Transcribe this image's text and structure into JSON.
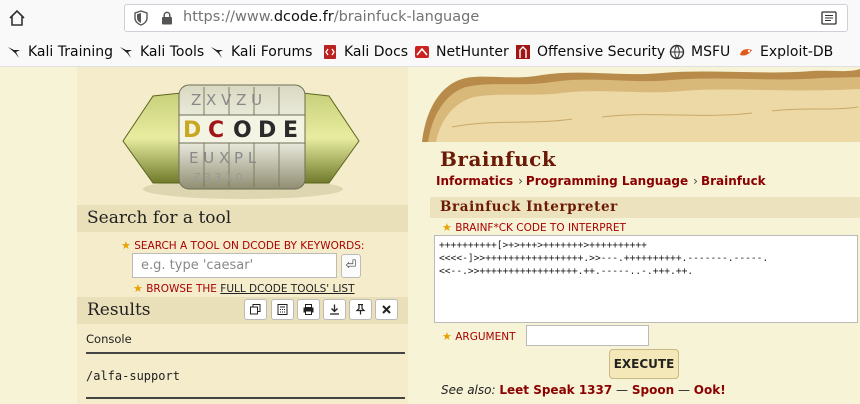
{
  "browser": {
    "url_prefix": "https://www.",
    "url_host": "dcode.fr",
    "url_path": "/brainfuck-language"
  },
  "bookmarks": [
    {
      "label": "Kali Training",
      "icon": "kali-dragon-icon"
    },
    {
      "label": "Kali Tools",
      "icon": "kali-dragon-icon"
    },
    {
      "label": "Kali Forums",
      "icon": "kali-dragon-icon"
    },
    {
      "label": "Kali Docs",
      "icon": "kali-docs-icon"
    },
    {
      "label": "NetHunter",
      "icon": "nethunter-icon"
    },
    {
      "label": "Offensive Security",
      "icon": "offsec-icon"
    },
    {
      "label": "MSFU",
      "icon": "msfu-icon"
    },
    {
      "label": "Exploit-DB",
      "icon": "exploit-db-icon"
    }
  ],
  "left": {
    "search_title": "Search for a tool",
    "search_keywords_label": "SEARCH A TOOL ON DCODE BY KEYWORDS:",
    "search_placeholder": "e.g. type 'caesar'",
    "search_go": "⏎",
    "browse_prefix": "BROWSE THE ",
    "browse_link": "FULL DCODE TOOLS' LIST",
    "results_title": "Results",
    "console_label": "Console",
    "console_output": "/alfa-support"
  },
  "right": {
    "title": "Brainfuck",
    "breadcrumbs": [
      "Informatics",
      "Programming Language",
      "Brainfuck"
    ],
    "interpreter_title": "Brainfuck Interpreter",
    "code_label": "BRAINF*CK CODE TO INTERPRET",
    "code_value": "++++++++++[>+>+++>+++++++>++++++++++\n<<<<-]>>+++++++++++++++++.>>---.++++++++++.-------.-----.\n<<--.>>+++++++++++++++++.++.-----..-.+++.++.",
    "argument_label": "ARGUMENT",
    "argument_value": "",
    "execute_label": "EXECUTE",
    "see_also_label": "See also:",
    "see_also": [
      "Leet Speak 1337",
      "Spoon",
      "Ook!"
    ]
  },
  "colors": {
    "accent_dark_red": "#8b0000",
    "heading_brown": "#6b1a05",
    "page_background": "#f6f3d6"
  }
}
